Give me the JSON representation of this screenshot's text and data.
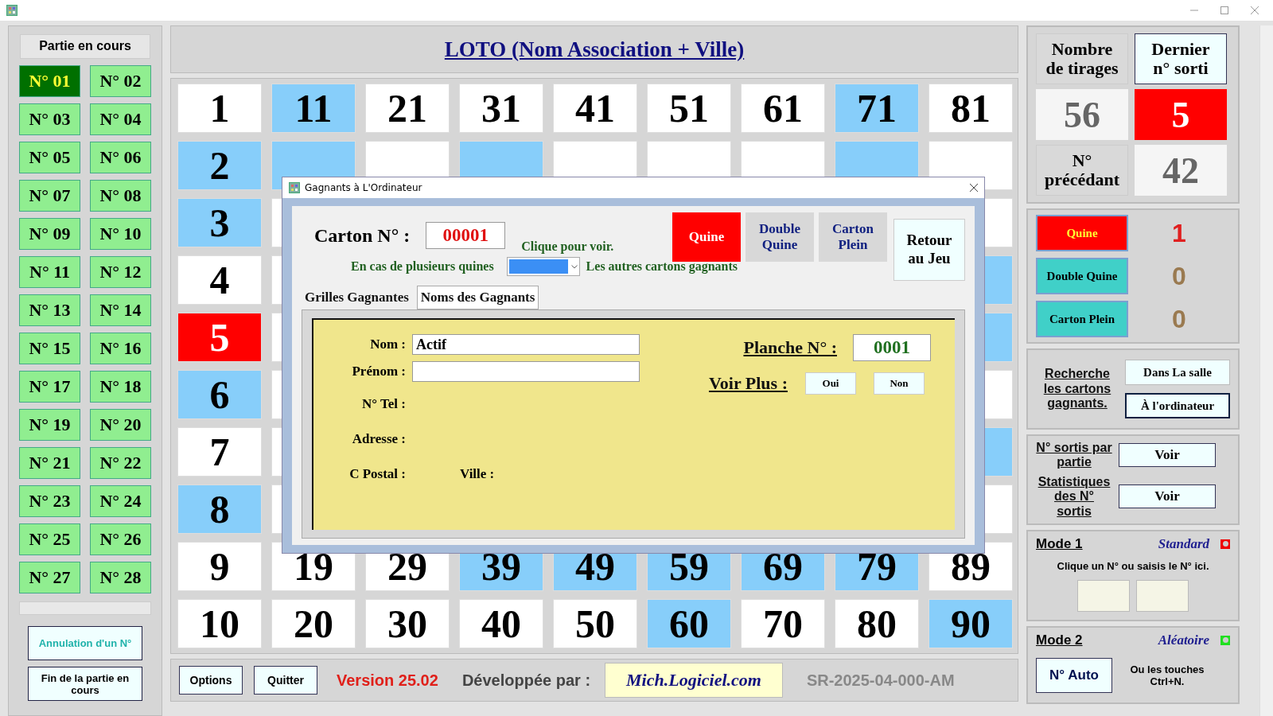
{
  "left": {
    "heading": "Partie en cours",
    "games": [
      {
        "label": "N° 01",
        "selected": true
      },
      {
        "label": "N° 02",
        "selected": false
      },
      {
        "label": "N° 03",
        "selected": false
      },
      {
        "label": "N° 04",
        "selected": false
      },
      {
        "label": "N° 05",
        "selected": false
      },
      {
        "label": "N° 06",
        "selected": false
      },
      {
        "label": "N° 07",
        "selected": false
      },
      {
        "label": "N° 08",
        "selected": false
      },
      {
        "label": "N° 09",
        "selected": false
      },
      {
        "label": "N° 10",
        "selected": false
      },
      {
        "label": "N° 11",
        "selected": false
      },
      {
        "label": "N° 12",
        "selected": false
      },
      {
        "label": "N° 13",
        "selected": false
      },
      {
        "label": "N° 14",
        "selected": false
      },
      {
        "label": "N° 15",
        "selected": false
      },
      {
        "label": "N° 16",
        "selected": false
      },
      {
        "label": "N° 17",
        "selected": false
      },
      {
        "label": "N° 18",
        "selected": false
      },
      {
        "label": "N° 19",
        "selected": false
      },
      {
        "label": "N° 20",
        "selected": false
      },
      {
        "label": "N° 21",
        "selected": false
      },
      {
        "label": "N° 22",
        "selected": false
      },
      {
        "label": "N° 23",
        "selected": false
      },
      {
        "label": "N° 24",
        "selected": false
      },
      {
        "label": "N° 25",
        "selected": false
      },
      {
        "label": "N° 26",
        "selected": false
      },
      {
        "label": "N° 27",
        "selected": false
      },
      {
        "label": "N° 28",
        "selected": false
      }
    ],
    "buttons": [
      {
        "label": "Annulation d'un N°",
        "kind": "cancel"
      },
      {
        "label": "Fin de la partie en cours",
        "kind": "end"
      }
    ]
  },
  "title": "LOTO (Nom Association + Ville)",
  "grid": [
    {
      "cells": [
        {
          "n": "1",
          "drawn": false,
          "last": false
        },
        {
          "n": "11",
          "drawn": true,
          "last": false
        },
        {
          "n": "21",
          "drawn": false,
          "last": false
        },
        {
          "n": "31",
          "drawn": false,
          "last": false
        },
        {
          "n": "41",
          "drawn": false,
          "last": false
        },
        {
          "n": "51",
          "drawn": false,
          "last": false
        },
        {
          "n": "61",
          "drawn": false,
          "last": false
        },
        {
          "n": "71",
          "drawn": true,
          "last": false
        },
        {
          "n": "81",
          "drawn": false,
          "last": false
        }
      ]
    },
    {
      "cells": [
        {
          "n": "2",
          "drawn": true,
          "last": false
        },
        {
          "drawn": true,
          "last": false
        },
        {
          "drawn": false,
          "last": false
        },
        {
          "drawn": true,
          "last": false
        },
        {
          "drawn": false,
          "last": false
        },
        {
          "drawn": false,
          "last": false
        },
        {
          "drawn": false,
          "last": false
        },
        {
          "drawn": true,
          "last": false
        },
        {
          "drawn": false,
          "last": false
        }
      ]
    },
    {
      "cells": [
        {
          "n": "3",
          "drawn": true,
          "last": false
        },
        {
          "drawn": false,
          "last": false
        }
      ]
    },
    {
      "cells": [
        {
          "n": "4",
          "drawn": false,
          "last": false
        },
        {
          "drawn": true,
          "last": false
        }
      ]
    },
    {
      "cells": [
        {
          "n": "5",
          "last": true
        },
        {
          "drawn": true,
          "last": false
        }
      ]
    },
    {
      "cells": [
        {
          "n": "6",
          "drawn": true,
          "last": false
        },
        {
          "drawn": false,
          "last": false
        }
      ]
    },
    {
      "cells": [
        {
          "n": "7",
          "drawn": false,
          "last": false
        },
        {
          "drawn": true,
          "last": false
        }
      ]
    },
    {
      "cells": [
        {
          "n": "8",
          "drawn": true,
          "last": false
        },
        {
          "drawn": false,
          "last": false
        }
      ]
    },
    {
      "cells": [
        {
          "n": "9",
          "drawn": false,
          "last": false
        },
        {
          "n": "19",
          "drawn": false,
          "last": false
        },
        {
          "n": "29",
          "drawn": false,
          "last": false
        },
        {
          "n": "39",
          "drawn": true,
          "last": false
        },
        {
          "n": "49",
          "drawn": true,
          "last": false
        },
        {
          "n": "59",
          "drawn": true,
          "last": false
        },
        {
          "n": "69",
          "drawn": true,
          "last": false
        },
        {
          "n": "79",
          "drawn": true,
          "last": false
        },
        {
          "n": "89",
          "drawn": false,
          "last": false
        }
      ]
    },
    {
      "cells": [
        {
          "n": "10",
          "drawn": false,
          "last": false
        },
        {
          "n": "20",
          "drawn": false,
          "last": false
        },
        {
          "n": "30",
          "drawn": false,
          "last": false
        },
        {
          "n": "40",
          "drawn": false,
          "last": false
        },
        {
          "n": "50",
          "drawn": false,
          "last": false
        },
        {
          "n": "60",
          "drawn": true,
          "last": false
        },
        {
          "n": "70",
          "drawn": false,
          "last": false
        },
        {
          "n": "80",
          "drawn": false,
          "last": false
        },
        {
          "n": "90",
          "drawn": true,
          "last": false
        }
      ]
    }
  ],
  "bottom": {
    "buttons": [
      "Options",
      "Quitter"
    ],
    "version": "Version 25.02",
    "dev_label": "Développée par :",
    "dev_link": "Mich.Logiciel.com",
    "serial": "SR-2025-04-000-AM"
  },
  "stats": {
    "count_label": "Nombre de tirages",
    "last_label": "Dernier n° sorti",
    "count": "56",
    "last": "5",
    "prev_label": "N° précédant",
    "prev": "42"
  },
  "prizes": [
    {
      "label": "Quine",
      "count": "1",
      "won": true
    },
    {
      "label": "Double Quine",
      "count": "0",
      "won": false
    },
    {
      "label": "Carton Plein",
      "count": "0",
      "won": false
    }
  ],
  "search": {
    "label": "Recherche les cartons gagnants.",
    "buttons": [
      {
        "label": "Dans La salle",
        "selected": false
      },
      {
        "label": "À l'ordinateur",
        "selected": true
      }
    ]
  },
  "views": [
    {
      "label": "N° sortis par partie",
      "button": "Voir"
    },
    {
      "label": "Statistiques des N° sortis",
      "button": "Voir"
    }
  ],
  "modes": [
    {
      "kind": "manual",
      "title": "Mode 1",
      "name": "Standard",
      "on": false,
      "hint": "Clique un N° ou saisis le N° ici."
    },
    {
      "kind": "auto",
      "title": "Mode 2",
      "name": "Aléatoire",
      "on": true,
      "button": "N° Auto",
      "hint": "Ou les touches Ctrl+N."
    }
  ],
  "dialog": {
    "title": "Gagnants à L'Ordinateur",
    "carton_label": "Carton N° :",
    "carton": "00001",
    "hint": "Clique pour voir.",
    "prize_tabs": [
      {
        "label": "Quine",
        "selected": true
      },
      {
        "label": "Double Quine",
        "selected": false
      },
      {
        "label": "Carton Plein",
        "selected": false
      }
    ],
    "return_button": "Retour au Jeu",
    "multi_label": "En cas de plusieurs quines",
    "others_label": "Les autres cartons gagnants",
    "tabs": [
      {
        "label": "Grilles Gagnantes",
        "selected": false
      },
      {
        "label": "Noms des Gagnants",
        "selected": true
      }
    ],
    "fields": [
      {
        "label": "Nom :",
        "kind": "input",
        "value": "Actif"
      },
      {
        "label": "Prénom :",
        "kind": "input"
      },
      {
        "label": "N° Tel :",
        "kind": "plain"
      },
      {
        "label": "Adresse  :",
        "kind": "plain"
      }
    ],
    "postal_label": "C Postal :",
    "city_label": "Ville :",
    "planche_label": "Planche N° :",
    "planche": "0001",
    "more_label": "Voir Plus :",
    "more_buttons": [
      "Oui",
      "Non"
    ]
  }
}
